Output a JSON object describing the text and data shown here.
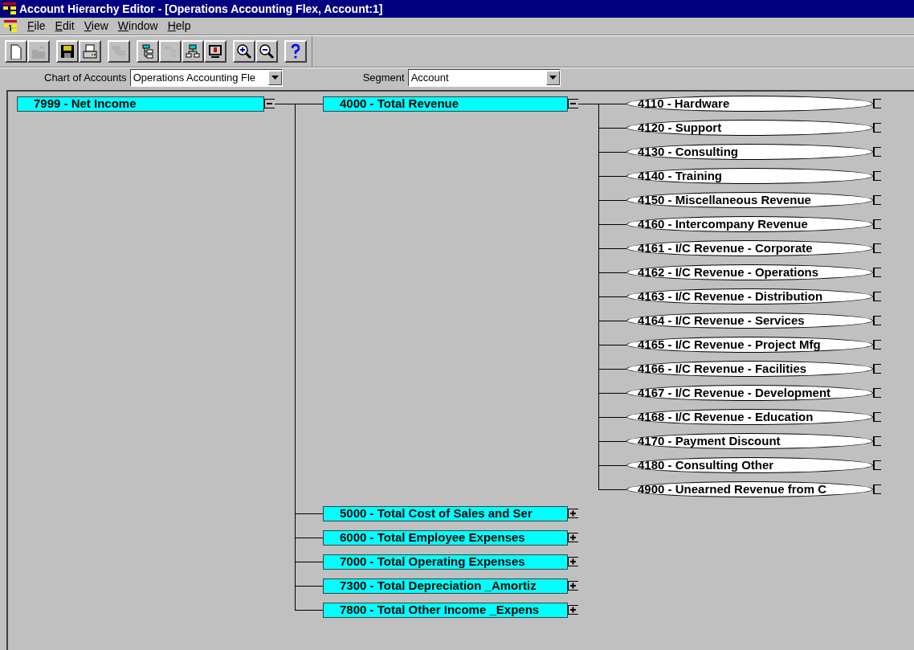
{
  "window": {
    "title": "Account Hierarchy Editor - [Operations Accounting Flex, Account:1]"
  },
  "menu": [
    "File",
    "Edit",
    "View",
    "Window",
    "Help"
  ],
  "toolbar_groups": [
    [
      {
        "disabled": false
      },
      {
        "disabled": true
      }
    ],
    [
      {
        "disabled": false
      },
      {
        "disabled": false
      }
    ],
    [
      {
        "disabled": true
      }
    ],
    [
      {
        "disabled": false
      },
      {
        "disabled": true
      },
      {
        "disabled": false
      },
      {
        "disabled": false
      }
    ],
    [
      {
        "disabled": false
      },
      {
        "disabled": false
      }
    ],
    [
      {
        "disabled": false
      }
    ]
  ],
  "filters": [
    {
      "label": "Chart of Accounts",
      "value": "Operations Accounting Fle"
    },
    {
      "label": "Segment",
      "value": "Account"
    }
  ],
  "tree": {
    "label": "7999 - Net Income",
    "kind": "summary",
    "expanded": true,
    "children": [
      {
        "label": "4000 - Total  Revenue",
        "kind": "summary",
        "expanded": true,
        "children": [
          {
            "label": "4110 - Hardware",
            "kind": "leaf"
          },
          {
            "label": "4120 - Support",
            "kind": "leaf"
          },
          {
            "label": "4130 - Consulting",
            "kind": "leaf"
          },
          {
            "label": "4140 - Training",
            "kind": "leaf"
          },
          {
            "label": "4150 - Miscellaneous Revenue",
            "kind": "leaf"
          },
          {
            "label": "4160 - Intercompany Revenue",
            "kind": "leaf"
          },
          {
            "label": "4161 - I/C Revenue - Corporate",
            "kind": "leaf"
          },
          {
            "label": "4162 - I/C Revenue - Operations",
            "kind": "leaf"
          },
          {
            "label": "4163 - I/C Revenue - Distribution",
            "kind": "leaf"
          },
          {
            "label": "4164 - I/C Revenue - Services",
            "kind": "leaf"
          },
          {
            "label": "4165 - I/C Revenue - Project Mfg",
            "kind": "leaf"
          },
          {
            "label": "4166 - I/C Revenue - Facilities",
            "kind": "leaf"
          },
          {
            "label": "4167 - I/C Revenue - Development",
            "kind": "leaf"
          },
          {
            "label": "4168 - I/C Revenue - Education",
            "kind": "leaf"
          },
          {
            "label": "4170 - Payment Discount",
            "kind": "leaf"
          },
          {
            "label": "4180 - Consulting Other",
            "kind": "leaf"
          },
          {
            "label": "4900 - Unearned Revenue from C",
            "kind": "leaf"
          }
        ]
      },
      {
        "label": "5000 - Total Cost of Sales and Ser",
        "kind": "summary",
        "expanded": false
      },
      {
        "label": "6000 - Total Employee Expenses",
        "kind": "summary",
        "expanded": false
      },
      {
        "label": "7000 - Total Operating Expenses",
        "kind": "summary",
        "expanded": false
      },
      {
        "label": "7300 - Total Depreciation _Amortiz",
        "kind": "summary",
        "expanded": false
      },
      {
        "label": "7800 - Total Other Income _Expens",
        "kind": "summary",
        "expanded": false
      }
    ]
  }
}
